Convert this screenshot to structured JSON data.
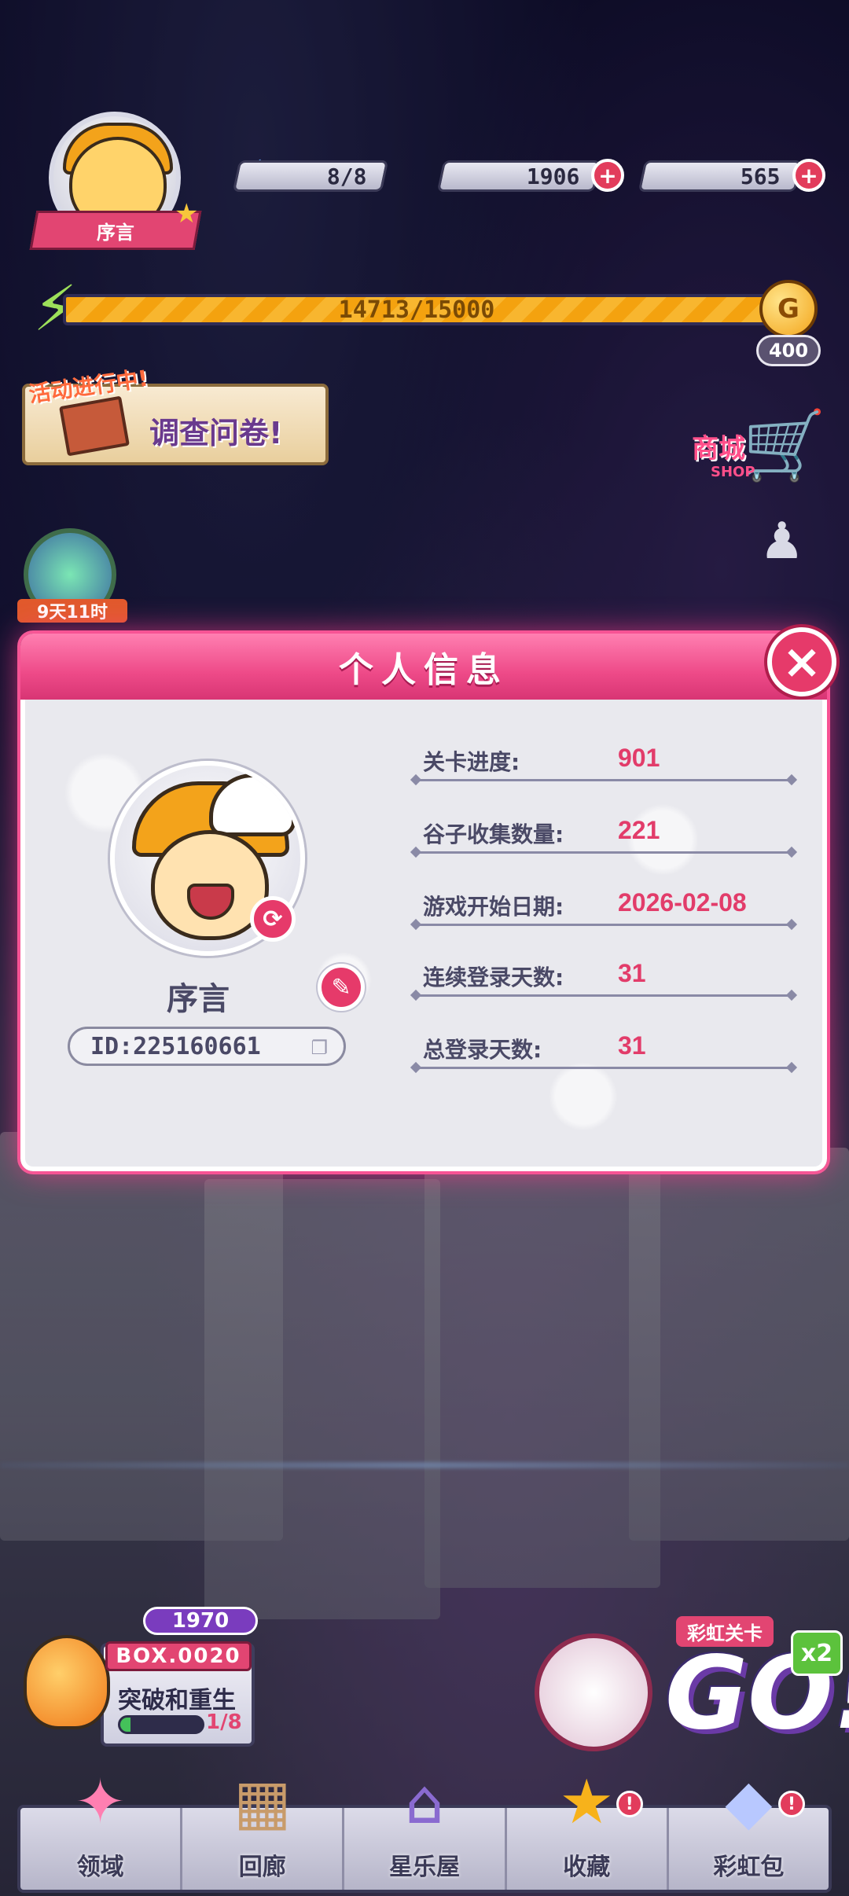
{
  "player": {
    "name": "序言",
    "id_text": "ID:225160661"
  },
  "resources": {
    "energy": "8/8",
    "coins": "1906",
    "gems": "565",
    "plus": "+"
  },
  "xp": {
    "text": "14713/15000",
    "fraction": 0.981,
    "coin_reward": "400"
  },
  "event": {
    "tag": "活动进行中!",
    "title": "调查问卷!"
  },
  "shop": {
    "label": "商城",
    "sub": "SHOP"
  },
  "timer": {
    "label": "9天11时"
  },
  "modal": {
    "title": "个人信息",
    "close_icon": "×",
    "stats": [
      {
        "label": "关卡进度:",
        "value": "901"
      },
      {
        "label": "谷子收集数量:",
        "value": "221"
      },
      {
        "label": "游戏开始日期:",
        "value": "2026-02-08"
      },
      {
        "label": "连续登录天数:",
        "value": "31"
      },
      {
        "label": "总登录天数:",
        "value": "31"
      }
    ]
  },
  "box": {
    "gems": "1970",
    "tag": "BOX.0020",
    "name": "突破和重生",
    "count": "1/8",
    "progress": 0.125
  },
  "go_panel": {
    "rainbow_label": "彩虹关卡",
    "go_text": "GO!",
    "multiplier": "x2"
  },
  "nav": [
    {
      "label": "领域",
      "icon": "domain-icon",
      "glyph": "✦",
      "badge": ""
    },
    {
      "label": "回廊",
      "icon": "gallery-icon",
      "glyph": "▦",
      "badge": ""
    },
    {
      "label": "星乐屋",
      "icon": "house-icon",
      "glyph": "⌂",
      "badge": ""
    },
    {
      "label": "收藏",
      "icon": "star-icon",
      "glyph": "★",
      "badge": "!"
    },
    {
      "label": "彩虹包",
      "icon": "rainbow-pack-icon",
      "glyph": "◆",
      "badge": "!"
    }
  ],
  "colors": {
    "accent": "#e63a6a",
    "header": "#ee4a88",
    "stat_value": "#e23c6a",
    "label": "#4a4966"
  }
}
